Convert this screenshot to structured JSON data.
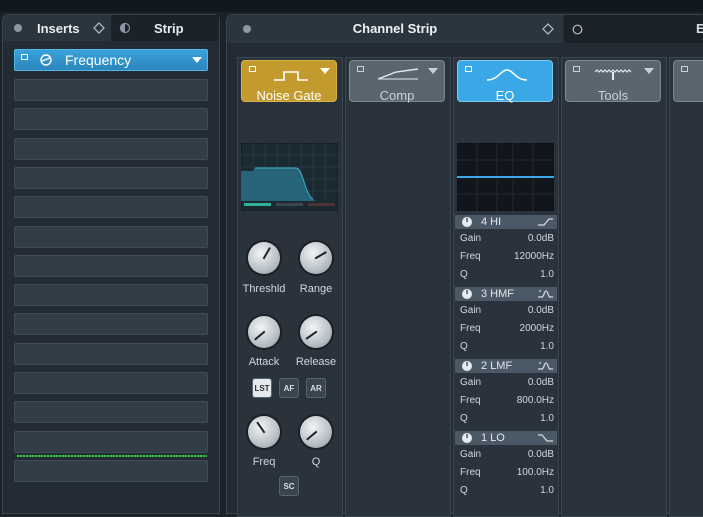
{
  "inserts": {
    "tab_inserts": "Inserts",
    "tab_strip": "Strip",
    "plugin_name": "Frequency",
    "slot_count": 14
  },
  "channel_strip": {
    "title": "Channel Strip",
    "modules": {
      "noise_gate": {
        "name": "Noise Gate",
        "color": "#c39a2d"
      },
      "comp": {
        "name": "Comp"
      },
      "eq": {
        "name": "EQ",
        "color": "#3aa8e6"
      },
      "tools": {
        "name": "Tools"
      }
    },
    "gate": {
      "knobs": {
        "threshold": "Threshld",
        "range": "Range",
        "attack": "Attack",
        "release": "Release",
        "freq": "Freq",
        "q": "Q"
      },
      "buttons": {
        "lst": "LST",
        "af": "AF",
        "ar": "AR",
        "sc": "SC"
      }
    },
    "eq_bands": [
      {
        "name": "4 HI",
        "gain": "0.0dB",
        "freq": "12000Hz",
        "q": "1.0"
      },
      {
        "name": "3 HMF",
        "gain": "0.0dB",
        "freq": "2000Hz",
        "q": "1.0"
      },
      {
        "name": "2 LMF",
        "gain": "0.0dB",
        "freq": "800.0Hz",
        "q": "1.0"
      },
      {
        "name": "1 LO",
        "gain": "0.0dB",
        "freq": "100.0Hz",
        "q": "1.0"
      }
    ],
    "eq_labels": {
      "gain": "Gain",
      "freq": "Freq",
      "q": "Q"
    }
  }
}
